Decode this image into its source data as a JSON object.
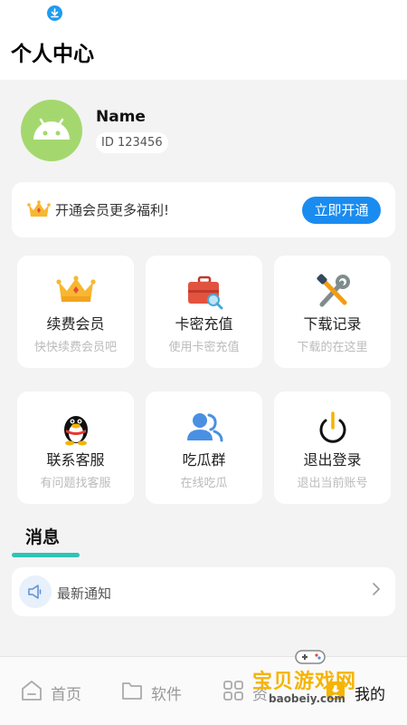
{
  "header": {
    "title": "个人中心"
  },
  "profile": {
    "name": "Name",
    "id_text": "ID 123456"
  },
  "vip": {
    "text": "开通会员更多福利!",
    "button": "立即开通"
  },
  "grid": [
    {
      "title": "续费会员",
      "subtitle": "快快续费会员吧",
      "icon": "crown-icon"
    },
    {
      "title": "卡密充值",
      "subtitle": "使用卡密充值",
      "icon": "briefcase-search-icon"
    },
    {
      "title": "下载记录",
      "subtitle": "下载的在这里",
      "icon": "tools-icon"
    },
    {
      "title": "联系客服",
      "subtitle": "有问题找客服",
      "icon": "qq-penguin-icon"
    },
    {
      "title": "吃瓜群",
      "subtitle": "在线吃瓜",
      "icon": "group-users-icon"
    },
    {
      "title": "退出登录",
      "subtitle": "退出当前账号",
      "icon": "power-icon"
    }
  ],
  "messages": {
    "title": "消息",
    "notice": "最新通知"
  },
  "tabs": [
    {
      "label": "首页",
      "icon": "home-icon"
    },
    {
      "label": "软件",
      "icon": "folder-icon"
    },
    {
      "label": "资",
      "icon": "apps-grid-icon"
    },
    {
      "label": "我的",
      "icon": "profile-icon"
    }
  ],
  "watermark": {
    "name": "宝贝游戏网",
    "url": "baobeiy.com"
  },
  "colors": {
    "accent": "#1a8cf0",
    "underline": "#2ec4b6",
    "avatar": "#a4d86f"
  }
}
